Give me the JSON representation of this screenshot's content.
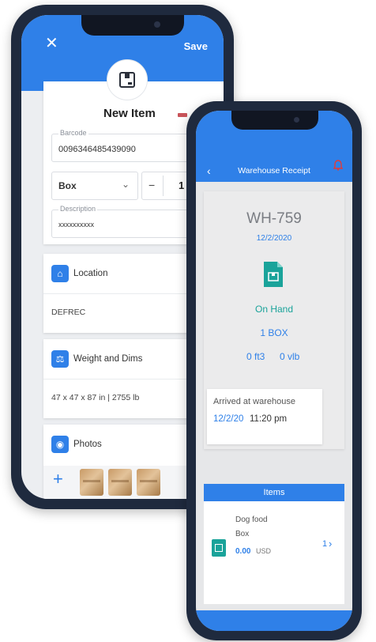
{
  "item_screen": {
    "save_label": "Save",
    "title": "New Item",
    "barcode": {
      "label": "Barcode",
      "value": "0096346485439090"
    },
    "unit": {
      "value": "Box"
    },
    "quantity": {
      "minus": "−",
      "value": "1",
      "plus": "+"
    },
    "description": {
      "label": "Description",
      "value": "xxxxxxxxxx"
    },
    "location": {
      "title": "Location",
      "value": "DEFREC"
    },
    "weight": {
      "title": "Weight and Dims",
      "value": "47 x 47 x 87 in | 2755 lb"
    },
    "photos": {
      "title": "Photos",
      "add_label": "+"
    },
    "accent": "#2f80e8"
  },
  "receipt_screen": {
    "title": "Warehouse Receipt",
    "back_label": "‹",
    "receipt_number": "WH-759",
    "date": "12/2/2020",
    "status": "On Hand",
    "pieces": "1 BOX",
    "volume": "0 ft3",
    "weight": "0 vlb",
    "arrived": {
      "label": "Arrived at warehouse",
      "date": "12/2/20",
      "time": "11:20 pm"
    },
    "items_header": "Items",
    "item": {
      "name": "Dog food",
      "unit": "Box",
      "price": "0.00",
      "currency": "USD",
      "count": "1"
    },
    "status_color": "#1aa39a"
  }
}
